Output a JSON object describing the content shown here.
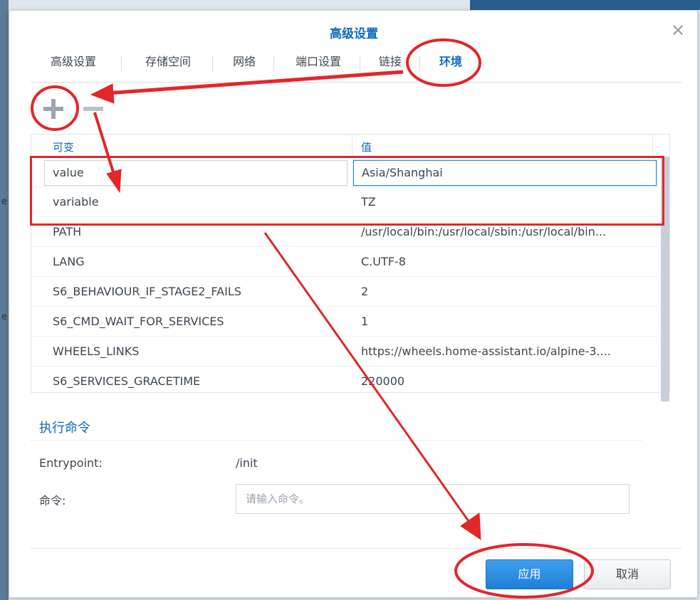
{
  "background": {
    "left_fragments": [
      "e",
      "e"
    ]
  },
  "dialog": {
    "title": "高级设置",
    "close_icon": "close-icon"
  },
  "tabs": [
    {
      "label": "高级设置",
      "active": false
    },
    {
      "label": "存储空间",
      "active": false
    },
    {
      "label": "网络",
      "active": false
    },
    {
      "label": "端口设置",
      "active": false
    },
    {
      "label": "链接",
      "active": false
    },
    {
      "label": "环境",
      "active": true
    }
  ],
  "toolbar": {
    "add_icon": "plus-icon",
    "remove_icon": "minus-icon"
  },
  "env_table": {
    "columns": {
      "variable": "可变",
      "value": "值"
    },
    "rows": [
      {
        "variable": "value",
        "value": "Asia/Shanghai",
        "editing": true
      },
      {
        "variable": "variable",
        "value": "TZ"
      },
      {
        "variable": "PATH",
        "value": "/usr/local/bin:/usr/local/sbin:/usr/local/bin..."
      },
      {
        "variable": "LANG",
        "value": "C.UTF-8"
      },
      {
        "variable": "S6_BEHAVIOUR_IF_STAGE2_FAILS",
        "value": "2"
      },
      {
        "variable": "S6_CMD_WAIT_FOR_SERVICES",
        "value": "1"
      },
      {
        "variable": "WHEELS_LINKS",
        "value": "https://wheels.home-assistant.io/alpine-3...."
      },
      {
        "variable": "S6_SERVICES_GRACETIME",
        "value": "220000"
      }
    ]
  },
  "execute": {
    "section_title": "执行命令",
    "entrypoint_label": "Entrypoint:",
    "entrypoint_value": "/init",
    "command_label": "命令:",
    "command_placeholder": "请输入命令。",
    "command_value": ""
  },
  "footer": {
    "apply_label": "应用",
    "cancel_label": "取消"
  },
  "annotations": {
    "color": "#e3262a"
  }
}
